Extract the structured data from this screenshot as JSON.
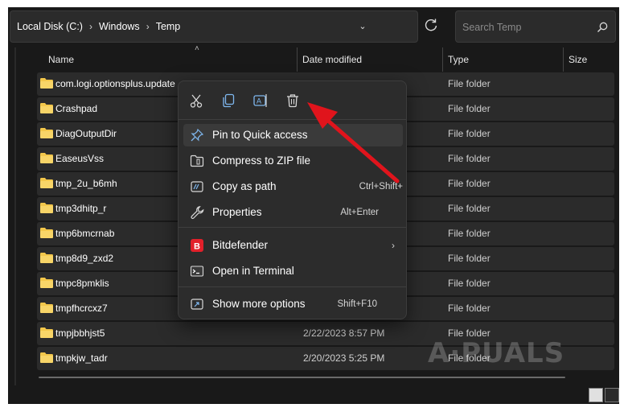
{
  "address": {
    "crumbs": [
      "Local Disk (C:)",
      "Windows",
      "Temp"
    ],
    "separator_icon": "chevron-right-icon"
  },
  "search": {
    "placeholder": "Search Temp"
  },
  "columns": {
    "name": "Name",
    "date": "Date modified",
    "type": "Type",
    "size": "Size"
  },
  "rows": [
    {
      "name": "com.logi.optionsplus.update",
      "date": "",
      "type": "File folder"
    },
    {
      "name": "Crashpad",
      "date": "",
      "type": "File folder"
    },
    {
      "name": "DiagOutputDir",
      "date": "",
      "type": "File folder"
    },
    {
      "name": "EaseusVss",
      "date": "",
      "type": "File folder"
    },
    {
      "name": "tmp_2u_b6mh",
      "date": "",
      "type": "File folder"
    },
    {
      "name": "tmp3dhitp_r",
      "date": "",
      "type": "File folder"
    },
    {
      "name": "tmp6bmcrnab",
      "date": "",
      "type": "File folder"
    },
    {
      "name": "tmp8d9_zxd2",
      "date": "",
      "type": "File folder"
    },
    {
      "name": "tmpc8pmklis",
      "date": "",
      "type": "File folder"
    },
    {
      "name": "tmpfhcrcxz7",
      "date": "",
      "type": "File folder"
    },
    {
      "name": "tmpjbbhjst5",
      "date": "2/22/2023 8:57 PM",
      "type": "File folder"
    },
    {
      "name": "tmpkjw_tadr",
      "date": "2/20/2023 5:25 PM",
      "type": "File folder"
    }
  ],
  "context_menu": {
    "toolbar": [
      "cut-icon",
      "copy-icon",
      "rename-icon",
      "delete-icon"
    ],
    "items": [
      {
        "label": "Pin to Quick access",
        "shortcut": "",
        "icon": "pin-icon"
      },
      {
        "label": "Compress to ZIP file",
        "shortcut": "",
        "icon": "zip-folder-icon"
      },
      {
        "label": "Copy as path",
        "shortcut": "Ctrl+Shift+",
        "icon": "copy-path-icon"
      },
      {
        "label": "Properties",
        "shortcut": "Alt+Enter",
        "icon": "wrench-icon"
      },
      {
        "label": "Bitdefender",
        "shortcut": "",
        "icon": "bitdefender-icon"
      },
      {
        "label": "Open in Terminal",
        "shortcut": "",
        "icon": "terminal-icon"
      },
      {
        "label": "Show more options",
        "shortcut": "Shift+F10",
        "icon": "share-icon"
      }
    ]
  },
  "colors": {
    "annotation_arrow": "#e0141c",
    "folder": "#f3c74b",
    "bitdefender": "#e2202a"
  }
}
